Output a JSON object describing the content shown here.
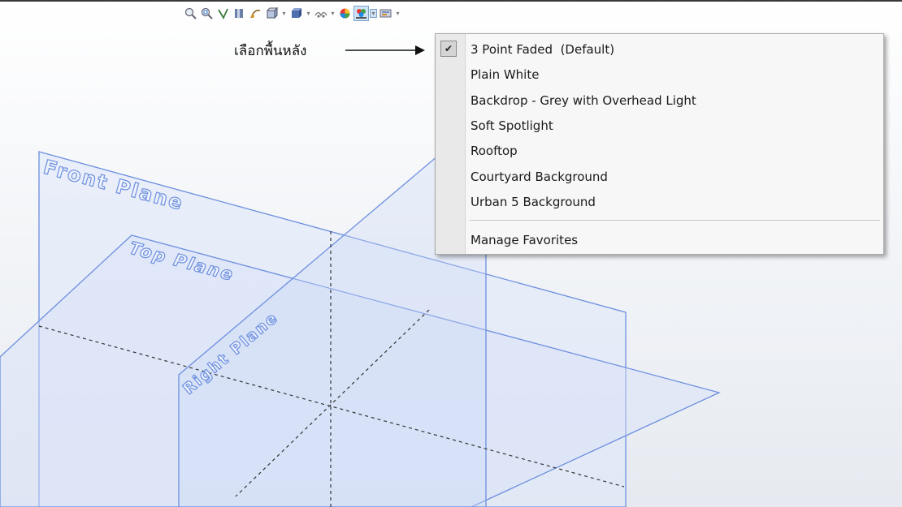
{
  "toolbar": {
    "icons": [
      "zoom-to-fit-icon",
      "zoom-area-icon",
      "previous-view-icon",
      "section-view-icon",
      "dynamic-annotation-icon",
      "view-orientation-icon",
      "display-style-icon",
      "hide-show-items-icon",
      "edit-appearance-icon",
      "apply-scene-icon",
      "view-settings-icon"
    ]
  },
  "callout": {
    "text": "เลือกพื้นหลัง"
  },
  "scene_menu": {
    "items": [
      {
        "label": "3 Point Faded  (Default)",
        "checked": true
      },
      {
        "label": "Plain White",
        "checked": false
      },
      {
        "label": "Backdrop - Grey with Overhead Light",
        "checked": false
      },
      {
        "label": "Soft Spotlight",
        "checked": false
      },
      {
        "label": "Rooftop",
        "checked": false
      },
      {
        "label": "Courtyard Background",
        "checked": false
      },
      {
        "label": "Urban 5 Background",
        "checked": false
      }
    ],
    "footer": "Manage Favorites",
    "check_mark": "✔"
  },
  "planes": {
    "front": "Front Plane",
    "top": "Top Plane",
    "right": "Right Plane"
  },
  "colors": {
    "plane_line": "#6d8fe0",
    "plane_fill": "#dce6fa",
    "menu_bg": "#f7f7f7"
  }
}
